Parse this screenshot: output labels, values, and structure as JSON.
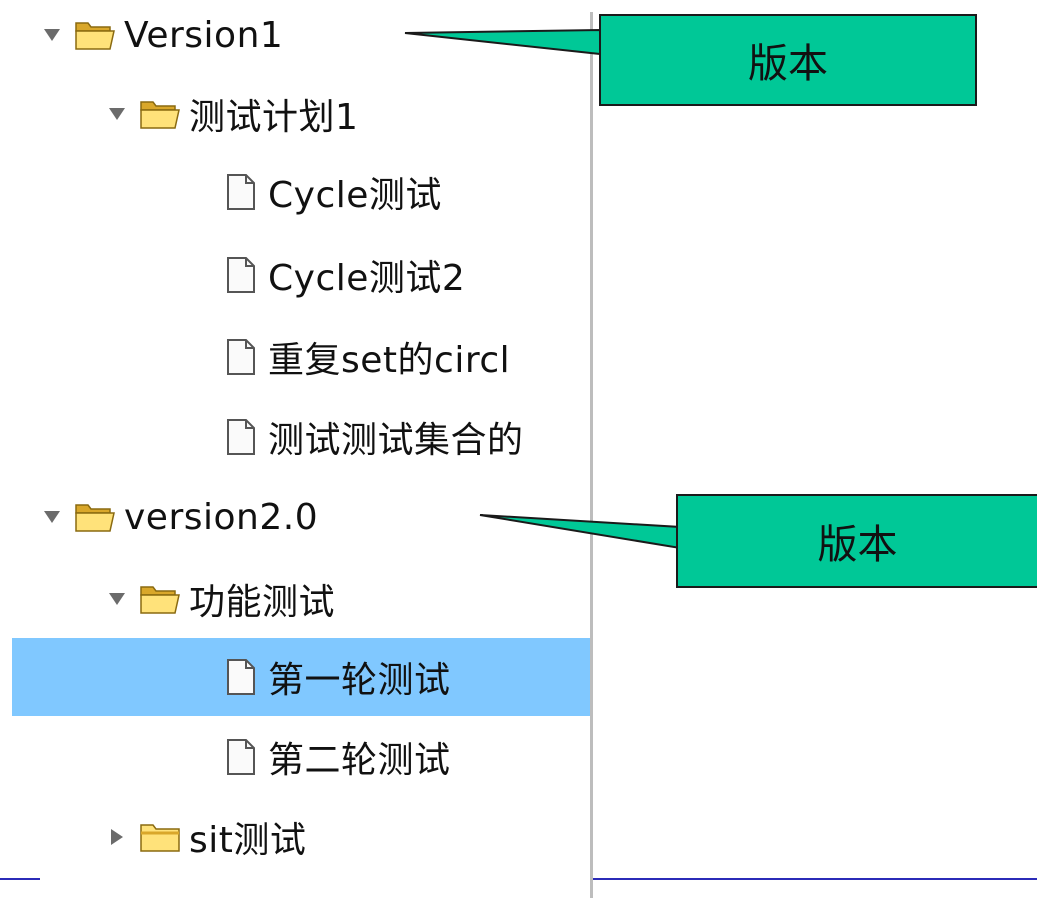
{
  "tree": {
    "items": [
      {
        "label": "Version1",
        "kind": "folder",
        "expanded": true
      },
      {
        "label": "测试计划1",
        "kind": "folder",
        "expanded": true
      },
      {
        "label": "Cycle测试",
        "kind": "file"
      },
      {
        "label": "Cycle测试2",
        "kind": "file"
      },
      {
        "label": "重复set的circl",
        "kind": "file"
      },
      {
        "label": "测试测试集合的",
        "kind": "file"
      },
      {
        "label": "version2.0",
        "kind": "folder",
        "expanded": true
      },
      {
        "label": "功能测试",
        "kind": "folder",
        "expanded": true
      },
      {
        "label": "第一轮测试",
        "kind": "file",
        "selected": true
      },
      {
        "label": "第二轮测试",
        "kind": "file"
      },
      {
        "label": "sit测试",
        "kind": "folder",
        "expanded": false
      }
    ]
  },
  "callouts": [
    {
      "text": "版本"
    },
    {
      "text": "版本"
    }
  ],
  "colors": {
    "selected_row": "#80c8ff",
    "callout_fill": "#00c897",
    "divider": "#bdbdbd",
    "bottom_rule": "#2b2bb8"
  }
}
